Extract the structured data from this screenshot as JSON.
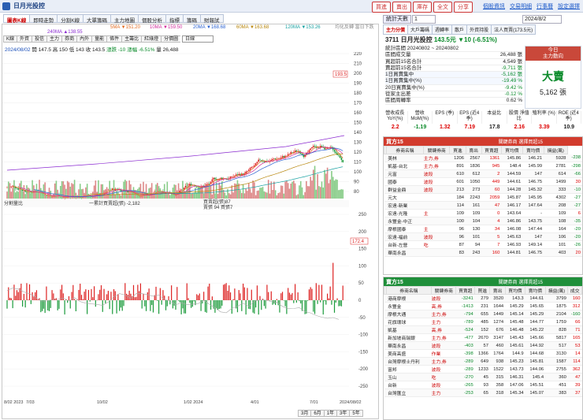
{
  "app": {
    "title": "日月光投控"
  },
  "top_actions": [
    "買進",
    "賣出",
    "庫存",
    "全文",
    "分享"
  ],
  "top_links": [
    "個股資訊",
    "交易明細",
    "行事曆",
    "設定選擇"
  ],
  "main_tabs": [
    "圖表K線",
    "即時走勢",
    "分割K線",
    "大單籌碼",
    "主力地圖",
    "個股分析",
    "指標",
    "籌碼",
    "財報試"
  ],
  "ma_legend": [
    "5MA ▼151.20",
    "10MA ▼159.50",
    "20MA ▼168.68",
    "60MA ▼163.68",
    "120MA ▼153.26",
    "240MA ▲138.55"
  ],
  "ma_colors": [
    "#e36a1f",
    "#d12b9b",
    "#2b62d1",
    "#b8860b",
    "#19a1a1",
    "#8b2bd1"
  ],
  "ma_note": "均化反轉 當日下跌",
  "toolbar": [
    "K線",
    "外資",
    "投信",
    "主力",
    "券商",
    "內外",
    "量能",
    "條件",
    "主籌比",
    "紅綠燈",
    "分價圖"
  ],
  "period_select": "日線",
  "stock_line": {
    "date": "2024/08/02",
    "open": "開 147.5",
    "high": "高 150",
    "low": "低 143",
    "close": "收 143.5",
    "change": "漲跌 -10",
    "pct": "漲幅 -6.51%",
    "vol": "量 26,488"
  },
  "price_axis": [
    "220",
    "210",
    "200",
    "190",
    "180",
    "170",
    "160",
    "150",
    "140",
    "130",
    "120",
    "110",
    "100",
    "90",
    "80"
  ],
  "high_label": "193.5",
  "sub_legend": {
    "title": "分割量比",
    "a": "一累計買賣超(張) -2,182",
    "b": "買賣超(張)87",
    "c": "賣張 94 買張7"
  },
  "sub_axis": [
    "250",
    "200",
    "150",
    "100",
    "50",
    "0",
    "-50",
    "-100",
    "-150",
    "-200",
    "-250"
  ],
  "sub_value": "172.4",
  "x_axis": [
    "8/02\n2023",
    "7/03",
    "10/02",
    "1/02\n2024",
    "4/01",
    "7/01",
    "2024/08/02"
  ],
  "bottom_bar": [
    "3月",
    "6月",
    "1年",
    "3年",
    "5年"
  ],
  "right": {
    "stat_days_label": "統計天數",
    "stat_days_val": "1",
    "date_select": "2024/8/2",
    "tabs": [
      "主力分價",
      "大戶籌碼",
      "週轉率",
      "散戶",
      "外資持股",
      "法人買賣(173.5元)"
    ],
    "quote": {
      "code_name": "3711 日月光投控",
      "price": "143.5元",
      "change": "▼10 (-6.51%)"
    },
    "stats": [
      {
        "k": "統計區間 20240802 ~ 20240802",
        "v": ""
      },
      {
        "k": "區間成交量",
        "v": "26,488 張"
      },
      {
        "k": "買超前15名合計",
        "v": "4,549 張"
      },
      {
        "k": "賣超前15名合計",
        "v": "-9,711 張"
      },
      {
        "k": "1日買賣集中",
        "v": "-5,162 張"
      },
      {
        "k": "1日買賣集中(%)",
        "v": "-19.49 %"
      },
      {
        "k": "20日買賣集中(%)",
        "v": "-9.42 %"
      },
      {
        "k": "從家主出差",
        "v": "-0.12 %"
      },
      {
        "k": "區間周轉率",
        "v": "0.62 %"
      }
    ],
    "today": {
      "h1": "今日",
      "h2": "主力動向",
      "signal": "大賣",
      "amount": "5,162 張"
    },
    "fin_headers": [
      "營收成長 YoY(%)",
      "營收 MoM(%)",
      "EPS (季)",
      "EPS (近4季)",
      "本益比",
      "股價 淨值比",
      "殖利率 (%)",
      "ROE (近4季)"
    ],
    "fin_values": [
      "2.2",
      "-1.19",
      "1.32",
      "7.19",
      "17.8",
      "2.16",
      "3.39",
      "10.9"
    ],
    "buy": {
      "title": "買方15",
      "sub": "關鍵券商 選擇買超15",
      "headers": [
        "",
        "券商名稱",
        "關鍵券商",
        "買進",
        "賣出",
        "買賣超",
        "買均價",
        "賣均價",
        "損益(萬)"
      ],
      "rows": [
        [
          "",
          "美林",
          "主力,券",
          "1206",
          "2567",
          "1361",
          "145.86",
          "146.21",
          "5928",
          "-238"
        ],
        [
          "",
          "凱基-台北",
          "主力,券",
          "891",
          "1836",
          "945",
          "148.4",
          "145.99",
          "2781",
          "-298"
        ],
        [
          "",
          "元富",
          "波段",
          "610",
          "612",
          "2",
          "144.59",
          "147",
          "614",
          "-66"
        ],
        [
          "",
          "國泰",
          "波段",
          "601",
          "1050",
          "449",
          "144.61",
          "146.75",
          "1499",
          "30"
        ],
        [
          "",
          "群益金鼎",
          "波段",
          "213",
          "273",
          "60",
          "144.28",
          "145.32",
          "333",
          "-10"
        ],
        [
          "",
          "元大",
          "",
          "184",
          "2243",
          "2059",
          "145.87",
          "145.95",
          "4302",
          "-27"
        ],
        [
          "",
          "宏遠-新業",
          "",
          "114",
          "161",
          "47",
          "146.17",
          "147.64",
          "208",
          "-27"
        ],
        [
          "",
          "宏遠-光隆",
          "主",
          "109",
          "109",
          "0",
          "143.64",
          "-",
          "109",
          "6"
        ],
        [
          "",
          "永豐金-中正",
          "",
          "100",
          "104",
          "4",
          "146.86",
          "143.75",
          "108",
          "-35"
        ],
        [
          "",
          "摩根國泰",
          "主",
          "96",
          "130",
          "34",
          "146.08",
          "147.44",
          "164",
          "-20"
        ],
        [
          "",
          "宏遠-福前",
          "波段",
          "96",
          "101",
          "5",
          "145.63",
          "147",
          "106",
          "-20"
        ],
        [
          "",
          "台新-左營",
          "吃",
          "87",
          "94",
          "7",
          "146.93",
          "149.14",
          "101",
          "-26"
        ],
        [
          "",
          "華南永昌",
          "",
          "83",
          "243",
          "160",
          "144.81",
          "146.75",
          "403",
          "20"
        ]
      ]
    },
    "sell": {
      "title": "賣方15",
      "sub": "關鍵券商 選擇賣超15",
      "headers": [
        "",
        "券商名稱",
        "關鍵券商",
        "買賣超",
        "買進",
        "賣出",
        "買均價",
        "賣均價",
        "損益(萬)",
        "成交"
      ],
      "rows": [
        [
          "",
          "港商摩根",
          "波段",
          "-3241",
          "279",
          "3520",
          "143.3",
          "144.61",
          "3799",
          "160"
        ],
        [
          "",
          "永豐金",
          "高,券",
          "-1413",
          "231",
          "1644",
          "145.29",
          "145.65",
          "1875",
          "312"
        ],
        [
          "",
          "摩根大通",
          "主力,券",
          "-794",
          "655",
          "1449",
          "145.14",
          "145.29",
          "2104",
          "-160"
        ],
        [
          "",
          "花旗環球",
          "主力",
          "-789",
          "485",
          "1274",
          "145.48",
          "144.77",
          "1759",
          "66"
        ],
        [
          "",
          "凱基",
          "高,券",
          "-524",
          "152",
          "676",
          "146.48",
          "145.22",
          "828",
          "71"
        ],
        [
          "",
          "新加坡商瑞銀",
          "主力,券",
          "-477",
          "2670",
          "3147",
          "145.43",
          "145.66",
          "5817",
          "165"
        ],
        [
          "",
          "華南永昌",
          "波段",
          "-403",
          "57",
          "460",
          "145.61",
          "144.92",
          "517",
          "53"
        ],
        [
          "",
          "美商高盛",
          "作業",
          "-398",
          "1366",
          "1764",
          "144.9",
          "144.68",
          "3130",
          "14"
        ],
        [
          "",
          "台灣摩根士丹利",
          "主力,券",
          "-289",
          "649",
          "938",
          "145.23",
          "145.81",
          "1587",
          "114"
        ],
        [
          "",
          "富邦",
          "波段",
          "-289",
          "1233",
          "1522",
          "143.73",
          "144.06",
          "2755",
          "362"
        ],
        [
          "",
          "玉山",
          "吃",
          "-270",
          "45",
          "315",
          "146.31",
          "145.4",
          "360",
          "47"
        ],
        [
          "",
          "台新",
          "波段",
          "-265",
          "93",
          "358",
          "147.06",
          "145.51",
          "451",
          "39"
        ],
        [
          "",
          "台灣匯立",
          "主力",
          "-253",
          "65",
          "318",
          "145.34",
          "145.07",
          "383",
          "37"
        ]
      ]
    }
  }
}
